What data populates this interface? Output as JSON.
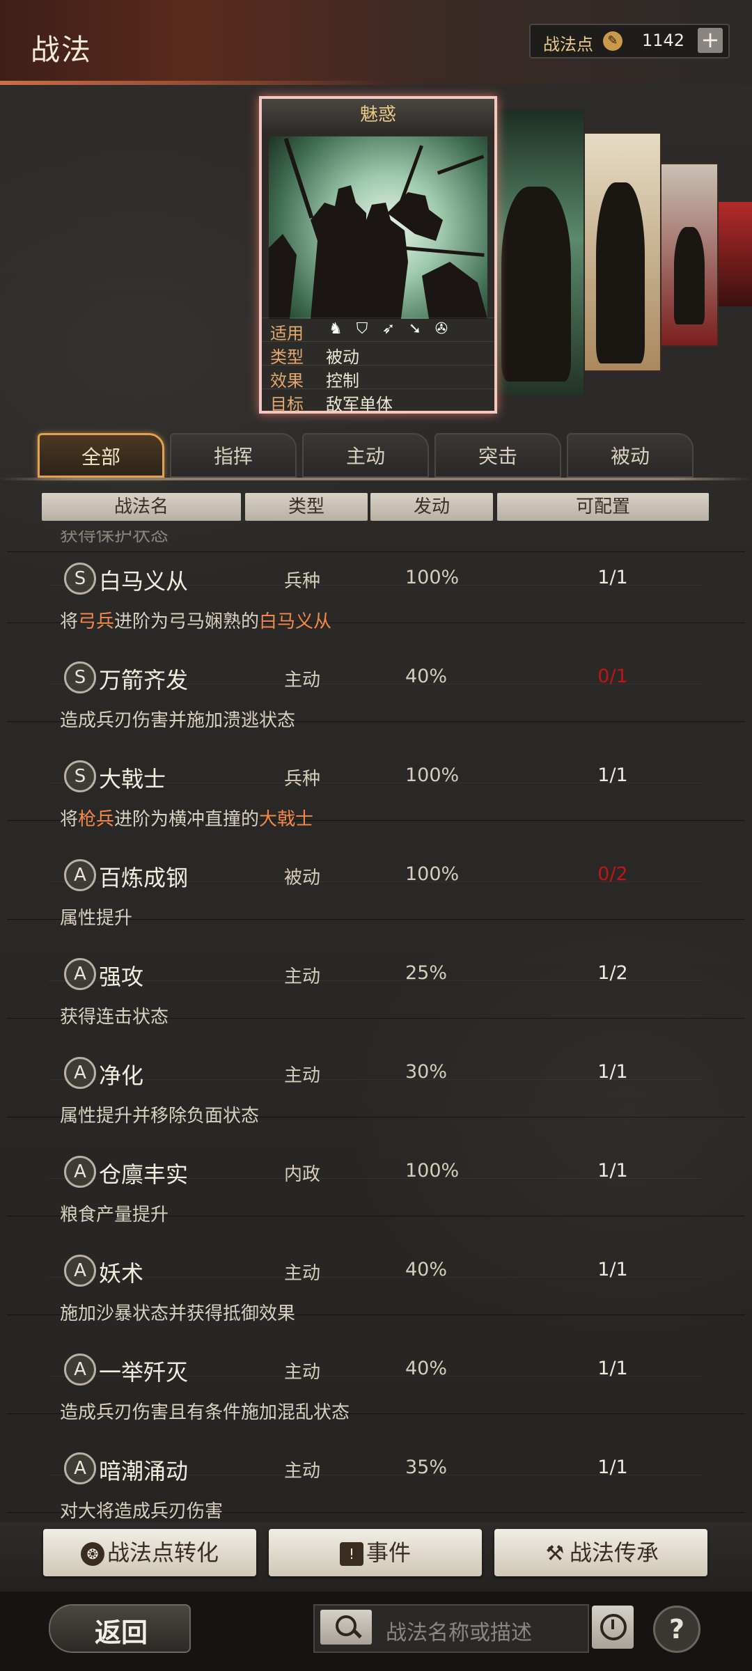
{
  "header": {
    "title": "战法",
    "points_label": "战法点",
    "points_value": "1142",
    "plus_label": "+"
  },
  "card": {
    "title": "魅惑",
    "rows": [
      {
        "label": "适用",
        "value": ""
      },
      {
        "label": "类型",
        "value": "被动"
      },
      {
        "label": "效果",
        "value": "控制"
      },
      {
        "label": "目标",
        "value": "敌军单体"
      }
    ],
    "troop_icons": [
      "cavalry-icon",
      "shield-icon",
      "archer-icon",
      "spear-icon",
      "chariot-icon"
    ]
  },
  "tabs": [
    "全部",
    "指挥",
    "主动",
    "突击",
    "被动"
  ],
  "columns": [
    "战法名",
    "类型",
    "发动",
    "可配置"
  ],
  "list_partial_top": "获得保护状态",
  "skills": [
    {
      "grade": "S",
      "name": "白马义从",
      "type": "兵种",
      "rate": "100%",
      "count": "1/1",
      "count_color": "#f0eadf",
      "desc_parts": [
        {
          "t": "将"
        },
        {
          "t": "弓兵",
          "hl": true
        },
        {
          "t": "进阶为弓马娴熟的"
        },
        {
          "t": "白马义从",
          "hl": true
        }
      ]
    },
    {
      "grade": "S",
      "name": "万箭齐发",
      "type": "主动",
      "rate": "40%",
      "count": "0/1",
      "count_color": "#c31414",
      "desc_parts": [
        {
          "t": "造成兵刃伤害并施加溃逃状态"
        }
      ]
    },
    {
      "grade": "S",
      "name": "大戟士",
      "type": "兵种",
      "rate": "100%",
      "count": "1/1",
      "count_color": "#f0eadf",
      "desc_parts": [
        {
          "t": "将"
        },
        {
          "t": "枪兵",
          "hl": true
        },
        {
          "t": "进阶为横冲直撞的"
        },
        {
          "t": "大戟士",
          "hl": true
        }
      ]
    },
    {
      "grade": "A",
      "name": "百炼成钢",
      "type": "被动",
      "rate": "100%",
      "count": "0/2",
      "count_color": "#c31414",
      "desc_parts": [
        {
          "t": "属性提升"
        }
      ]
    },
    {
      "grade": "A",
      "name": "强攻",
      "type": "主动",
      "rate": "25%",
      "count": "1/2",
      "count_color": "#f0eadf",
      "desc_parts": [
        {
          "t": "获得连击状态"
        }
      ]
    },
    {
      "grade": "A",
      "name": "净化",
      "type": "主动",
      "rate": "30%",
      "count": "1/1",
      "count_color": "#f0eadf",
      "desc_parts": [
        {
          "t": "属性提升并移除负面状态"
        }
      ]
    },
    {
      "grade": "A",
      "name": "仓廪丰实",
      "type": "内政",
      "rate": "100%",
      "count": "1/1",
      "count_color": "#f0eadf",
      "desc_parts": [
        {
          "t": "粮食产量提升"
        }
      ]
    },
    {
      "grade": "A",
      "name": "妖术",
      "type": "主动",
      "rate": "40%",
      "count": "1/1",
      "count_color": "#f0eadf",
      "desc_parts": [
        {
          "t": "施加沙暴状态并获得抵御效果"
        }
      ]
    },
    {
      "grade": "A",
      "name": "一举歼灭",
      "type": "主动",
      "rate": "40%",
      "count": "1/1",
      "count_color": "#f0eadf",
      "desc_parts": [
        {
          "t": "造成兵刃伤害且有条件施加混乱状态"
        }
      ]
    },
    {
      "grade": "A",
      "name": "暗潮涌动",
      "type": "主动",
      "rate": "35%",
      "count": "1/1",
      "count_color": "#f0eadf",
      "desc_parts": [
        {
          "t": "对大将造成兵刃伤害"
        }
      ]
    }
  ],
  "buttons": [
    {
      "label": "战法点转化",
      "icon": "points-convert-icon"
    },
    {
      "label": "事件",
      "icon": "event-icon"
    },
    {
      "label": "战法传承",
      "icon": "hammer-icon"
    }
  ],
  "footer": {
    "back_label": "返回",
    "search_placeholder": "战法名称或描述",
    "help_label": "?"
  }
}
